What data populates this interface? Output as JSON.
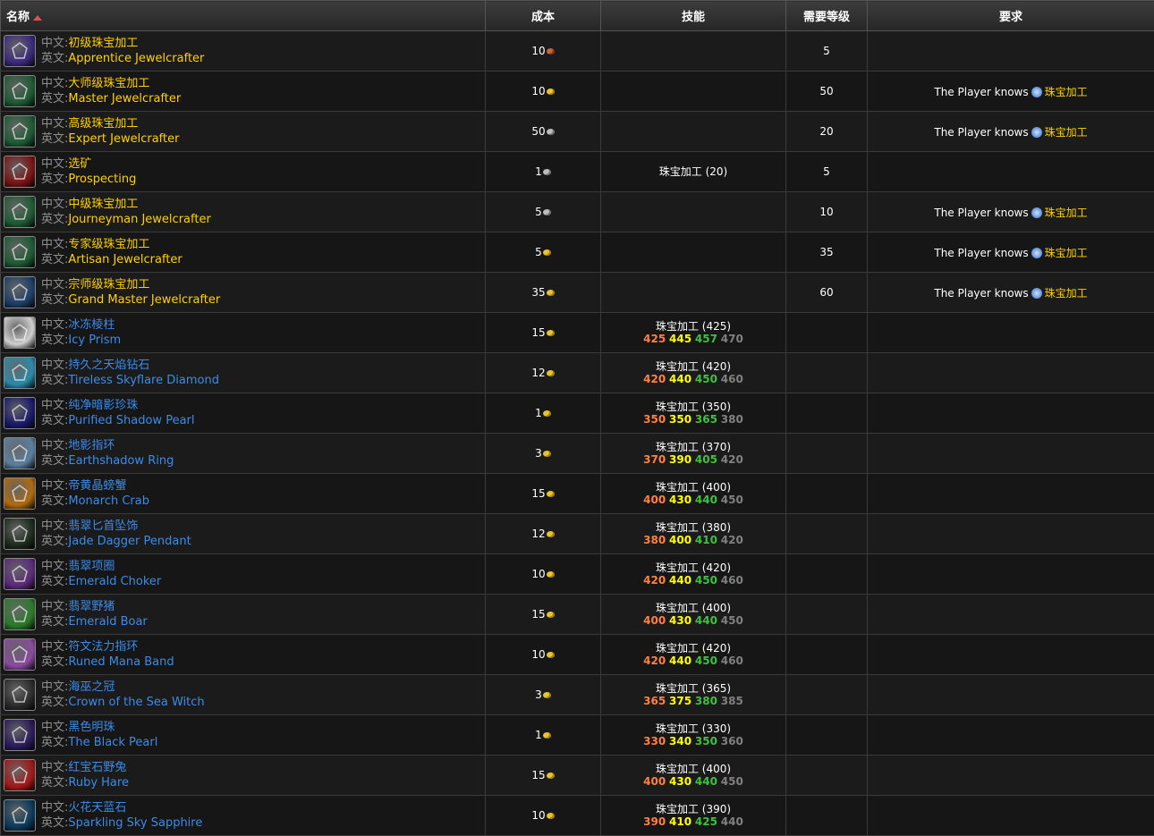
{
  "headers": {
    "name": "名称",
    "cost": "成本",
    "skill": "技能",
    "level": "需要等级",
    "req": "要求"
  },
  "label_cn": "中文:",
  "label_en": "英文:",
  "rows": [
    {
      "icon": "gem-purple-icon",
      "iconBg": "#3b2a7a",
      "cn": "初级珠宝加工",
      "en": "Apprentice Jewelcrafter",
      "color": "y",
      "cost": "10",
      "coin": "copper",
      "skill": "",
      "levels": [],
      "level": "5",
      "req": ""
    },
    {
      "icon": "gem-green-icon",
      "iconBg": "#1e5a34",
      "cn": "大师级珠宝加工",
      "en": "Master Jewelcrafter",
      "color": "y",
      "cost": "10",
      "coin": "gold",
      "skill": "",
      "levels": [],
      "level": "50",
      "req": "The Player knows",
      "reqLink": "珠宝加工"
    },
    {
      "icon": "gem-green-icon",
      "iconBg": "#1e5a34",
      "cn": "高级珠宝加工",
      "en": "Expert Jewelcrafter",
      "color": "y",
      "cost": "50",
      "coin": "silver",
      "skill": "",
      "levels": [],
      "level": "20",
      "req": "The Player knows",
      "reqLink": "珠宝加工"
    },
    {
      "icon": "ore-red-icon",
      "iconBg": "#7a1414",
      "cn": "选矿",
      "en": "Prospecting",
      "color": "y",
      "cost": "1",
      "coin": "silver",
      "skill": "珠宝加工 (20)",
      "levels": [],
      "level": "5",
      "req": ""
    },
    {
      "icon": "gem-green-icon",
      "iconBg": "#1e5a34",
      "cn": "中级珠宝加工",
      "en": "Journeyman Jewelcrafter",
      "color": "y",
      "cost": "5",
      "coin": "silver",
      "skill": "",
      "levels": [],
      "level": "10",
      "req": "The Player knows",
      "reqLink": "珠宝加工"
    },
    {
      "icon": "gem-green-icon",
      "iconBg": "#1e5a34",
      "cn": "专家级珠宝加工",
      "en": "Artisan Jewelcrafter",
      "color": "y",
      "cost": "5",
      "coin": "gold",
      "skill": "",
      "levels": [],
      "level": "35",
      "req": "The Player knows",
      "reqLink": "珠宝加工"
    },
    {
      "icon": "gem-blue-icon",
      "iconBg": "#1d3d66",
      "cn": "宗师级珠宝加工",
      "en": "Grand Master Jewelcrafter",
      "color": "y",
      "cost": "35",
      "coin": "gold",
      "skill": "",
      "levels": [],
      "level": "60",
      "req": "The Player knows",
      "reqLink": "珠宝加工"
    },
    {
      "icon": "prism-icon",
      "iconBg": "#cfcfcf",
      "cn": "冰冻棱柱",
      "en": "Icy Prism",
      "color": "b",
      "cost": "15",
      "coin": "gold",
      "skill": "珠宝加工 (425)",
      "levels": [
        "425",
        "445",
        "457",
        "470"
      ],
      "level": "",
      "req": ""
    },
    {
      "icon": "diamond-icon",
      "iconBg": "#2a8aa8",
      "cn": "持久之天焰钻石",
      "en": "Tireless Skyflare Diamond",
      "color": "b",
      "cost": "12",
      "coin": "gold",
      "skill": "珠宝加工 (420)",
      "levels": [
        "420",
        "440",
        "450",
        "460"
      ],
      "level": "",
      "req": ""
    },
    {
      "icon": "pearl-icon",
      "iconBg": "#1a1a6a",
      "cn": "纯净暗影珍珠",
      "en": "Purified Shadow Pearl",
      "color": "b",
      "cost": "1",
      "coin": "gold",
      "skill": "珠宝加工 (350)",
      "levels": [
        "350",
        "350",
        "365",
        "380"
      ],
      "level": "",
      "req": ""
    },
    {
      "icon": "ring-icon",
      "iconBg": "#5a7fa0",
      "cn": "地影指环",
      "en": "Earthshadow Ring",
      "color": "b",
      "cost": "3",
      "coin": "gold",
      "skill": "珠宝加工 (370)",
      "levels": [
        "370",
        "390",
        "405",
        "420"
      ],
      "level": "",
      "req": ""
    },
    {
      "icon": "crab-icon",
      "iconBg": "#b06a10",
      "cn": "帝黄晶螃蟹",
      "en": "Monarch Crab",
      "color": "b",
      "cost": "15",
      "coin": "gold",
      "skill": "珠宝加工 (400)",
      "levels": [
        "400",
        "430",
        "440",
        "450"
      ],
      "level": "",
      "req": ""
    },
    {
      "icon": "dagger-icon",
      "iconBg": "#1c2a1c",
      "cn": "翡翠匕首坠饰",
      "en": "Jade Dagger Pendant",
      "color": "b",
      "cost": "12",
      "coin": "gold",
      "skill": "珠宝加工 (380)",
      "levels": [
        "380",
        "400",
        "410",
        "420"
      ],
      "level": "",
      "req": ""
    },
    {
      "icon": "choker-icon",
      "iconBg": "#5a2a7a",
      "cn": "翡翠项圈",
      "en": "Emerald Choker",
      "color": "b",
      "cost": "10",
      "coin": "gold",
      "skill": "珠宝加工 (420)",
      "levels": [
        "420",
        "440",
        "450",
        "460"
      ],
      "level": "",
      "req": ""
    },
    {
      "icon": "boar-icon",
      "iconBg": "#2a7a2a",
      "cn": "翡翠野猪",
      "en": "Emerald Boar",
      "color": "b",
      "cost": "15",
      "coin": "gold",
      "skill": "珠宝加工 (400)",
      "levels": [
        "400",
        "430",
        "440",
        "450"
      ],
      "level": "",
      "req": ""
    },
    {
      "icon": "band-icon",
      "iconBg": "#8a4aa0",
      "cn": "符文法力指环",
      "en": "Runed Mana Band",
      "color": "b",
      "cost": "10",
      "coin": "gold",
      "skill": "珠宝加工 (420)",
      "levels": [
        "420",
        "440",
        "450",
        "460"
      ],
      "level": "",
      "req": ""
    },
    {
      "icon": "crown-icon",
      "iconBg": "#2a2a2a",
      "cn": "海巫之冠",
      "en": "Crown of the Sea Witch",
      "color": "b",
      "cost": "3",
      "coin": "gold",
      "skill": "珠宝加工 (365)",
      "levels": [
        "365",
        "375",
        "380",
        "385"
      ],
      "level": "",
      "req": ""
    },
    {
      "icon": "black-pearl-icon",
      "iconBg": "#2a1a5a",
      "cn": "黑色明珠",
      "en": "The Black Pearl",
      "color": "b",
      "cost": "1",
      "coin": "gold",
      "skill": "珠宝加工 (330)",
      "levels": [
        "330",
        "340",
        "350",
        "360"
      ],
      "level": "",
      "req": ""
    },
    {
      "icon": "hare-icon",
      "iconBg": "#a01818",
      "cn": "红宝石野兔",
      "en": "Ruby Hare",
      "color": "b",
      "cost": "15",
      "coin": "gold",
      "skill": "珠宝加工 (400)",
      "levels": [
        "400",
        "430",
        "440",
        "450"
      ],
      "level": "",
      "req": ""
    },
    {
      "icon": "sapphire-icon",
      "iconBg": "#0a3a5a",
      "cn": "火花天蓝石",
      "en": "Sparkling Sky Sapphire",
      "color": "b",
      "cost": "10",
      "coin": "gold",
      "skill": "珠宝加工 (390)",
      "levels": [
        "390",
        "410",
        "425",
        "440"
      ],
      "level": "",
      "req": ""
    }
  ]
}
